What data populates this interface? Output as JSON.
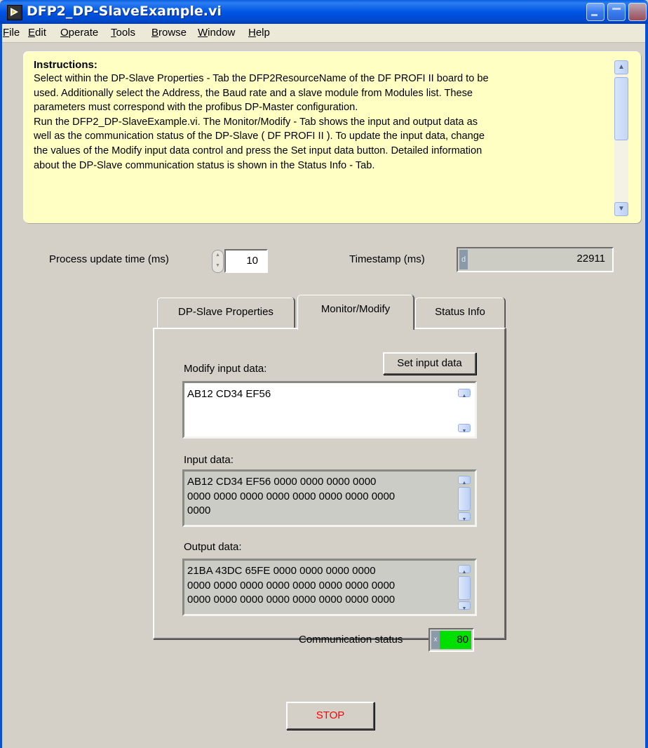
{
  "window": {
    "title": "DFP2_DP-SlaveExample.vi"
  },
  "menu": {
    "items": [
      "File",
      "Edit",
      "Operate",
      "Tools",
      "Browse",
      "Window",
      "Help"
    ]
  },
  "instructions": {
    "title": "Instructions:",
    "lines": [
      "Select within the DP-Slave Properties - Tab the DFP2ResourceName of the DF PROFI II board to be",
      "used. Additionally select  the Address, the Baud rate and a slave module from Modules list. These",
      "parameters must  correspond with the profibus DP-Master configuration.",
      "Run the DFP2_DP-SlaveExample.vi. The Monitor/Modify - Tab shows the input and output data as",
      "well as the communication status of the DP-Slave ( DF PROFI II ). To update the input data, change",
      "the values of the Modify input data control and press the Set input data button. Detailed information",
      "about the DP-Slave communication status is shown in the Status Info - Tab."
    ]
  },
  "process_update": {
    "label": "Process update time (ms)",
    "value": "10"
  },
  "timestamp": {
    "label": "Timestamp (ms)",
    "radix": "d",
    "value": "22911"
  },
  "tabs": [
    {
      "label": "DP-Slave Properties",
      "active": false
    },
    {
      "label": "Monitor/Modify",
      "active": true
    },
    {
      "label": "Status Info",
      "active": false
    }
  ],
  "monitor": {
    "modify_label": "Modify input data:",
    "set_button": "Set input data",
    "modify_value": "AB12 CD34 EF56",
    "input_label": "Input data:",
    "input_value": "AB12 CD34 EF56 0000 0000 0000 0000\n0000 0000 0000 0000 0000 0000 0000 0000\n0000",
    "output_label": "Output data:",
    "output_value": "21BA 43DC 65FE 0000 0000 0000 0000\n0000 0000 0000 0000 0000 0000 0000 0000\n0000 0000 0000 0000 0000 0000 0000 0000",
    "comm_label": "Communication status",
    "comm_radix": "x",
    "comm_value": "80"
  },
  "stop_button": "STOP",
  "colors": {
    "instructions_bg": "#ffffc4",
    "status_ok": "#00e000",
    "stop_text": "#ff0000",
    "titlebar": "#0055e5"
  }
}
